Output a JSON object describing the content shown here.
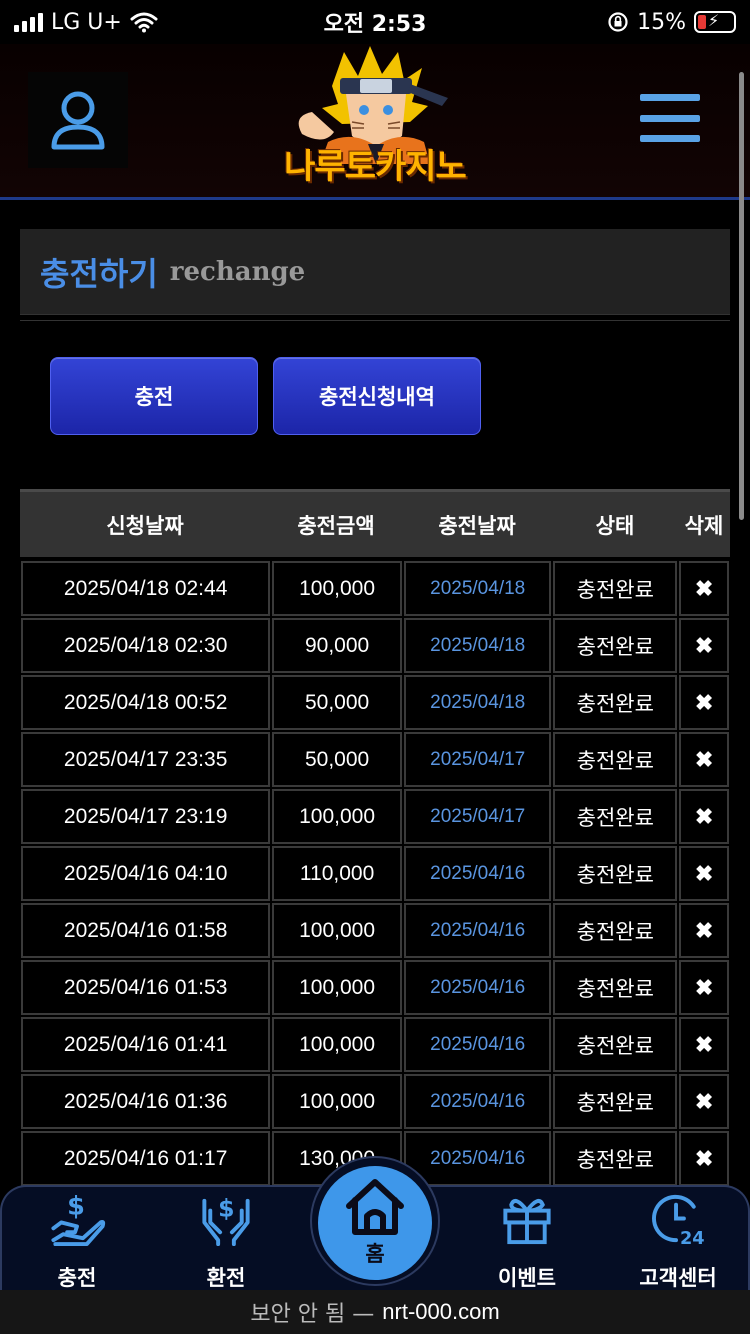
{
  "status_bar": {
    "carrier": "LG U+",
    "time": "오전 2:53",
    "battery": "15%"
  },
  "header": {
    "logo_text": "나루토카지노"
  },
  "page": {
    "title": "충전하기",
    "subtitle": "rechange"
  },
  "buttons": {
    "charge": "충전",
    "history": "충전신청내역"
  },
  "table": {
    "columns": [
      "신청날짜",
      "충전금액",
      "충전날짜",
      "상태",
      "삭제"
    ],
    "rows": [
      {
        "request_date": "2025/04/18 02:44",
        "amount": "100,000",
        "charge_date": "2025/04/18",
        "status": "충전완료"
      },
      {
        "request_date": "2025/04/18 02:30",
        "amount": "90,000",
        "charge_date": "2025/04/18",
        "status": "충전완료"
      },
      {
        "request_date": "2025/04/18 00:52",
        "amount": "50,000",
        "charge_date": "2025/04/18",
        "status": "충전완료"
      },
      {
        "request_date": "2025/04/17 23:35",
        "amount": "50,000",
        "charge_date": "2025/04/17",
        "status": "충전완료"
      },
      {
        "request_date": "2025/04/17 23:19",
        "amount": "100,000",
        "charge_date": "2025/04/17",
        "status": "충전완료"
      },
      {
        "request_date": "2025/04/16 04:10",
        "amount": "110,000",
        "charge_date": "2025/04/16",
        "status": "충전완료"
      },
      {
        "request_date": "2025/04/16 01:58",
        "amount": "100,000",
        "charge_date": "2025/04/16",
        "status": "충전완료"
      },
      {
        "request_date": "2025/04/16 01:53",
        "amount": "100,000",
        "charge_date": "2025/04/16",
        "status": "충전완료"
      },
      {
        "request_date": "2025/04/16 01:41",
        "amount": "100,000",
        "charge_date": "2025/04/16",
        "status": "충전완료"
      },
      {
        "request_date": "2025/04/16 01:36",
        "amount": "100,000",
        "charge_date": "2025/04/16",
        "status": "충전완료"
      },
      {
        "request_date": "2025/04/16 01:17",
        "amount": "130,000",
        "charge_date": "2025/04/16",
        "status": "충전완료"
      }
    ],
    "delete_glyph": "✖"
  },
  "bottom_nav": {
    "charge": "충전",
    "exchange": "환전",
    "home": "홈",
    "event": "이벤트",
    "support": "고객센터"
  },
  "url_bar": {
    "security": "보안 안 됨 —",
    "url": "nrt-000.com"
  },
  "colors": {
    "accent_blue": "#3e97ea",
    "button_blue": "#2331c2",
    "date_blue": "#5a95e0",
    "battery_low": "#e53935"
  }
}
